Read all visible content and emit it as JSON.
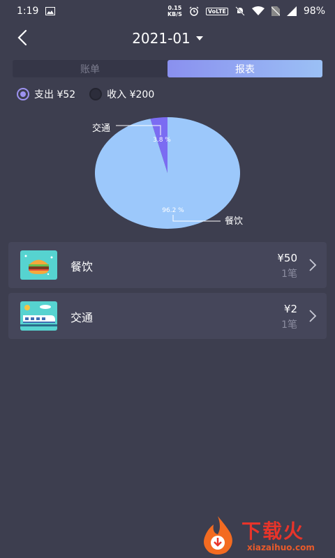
{
  "status_bar": {
    "time": "1:19",
    "net_speed_value": "0.15",
    "net_speed_unit": "KB/S",
    "volte": "VoLTE",
    "battery": "98%"
  },
  "header": {
    "month": "2021-01"
  },
  "tabs": {
    "bill": "账单",
    "report": "报表"
  },
  "toggle": {
    "expense_label": "支出 ¥52",
    "income_label": "收入 ¥200"
  },
  "chart_data": {
    "type": "pie",
    "slices": [
      {
        "label": "餐饮",
        "value": 96.2,
        "percent_label": "96.2 %",
        "color": "#9cc8fb"
      },
      {
        "label": "交通",
        "value": 3.8,
        "percent_label": "3.8 %",
        "color": "#7b6cf2"
      }
    ]
  },
  "categories": [
    {
      "name": "餐饮",
      "amount": "¥50",
      "count": "1笔",
      "icon": "burger-icon"
    },
    {
      "name": "交通",
      "amount": "¥2",
      "count": "1笔",
      "icon": "train-icon"
    }
  ],
  "watermark": {
    "title": "下载火",
    "url": "xiazaihuo.com"
  }
}
